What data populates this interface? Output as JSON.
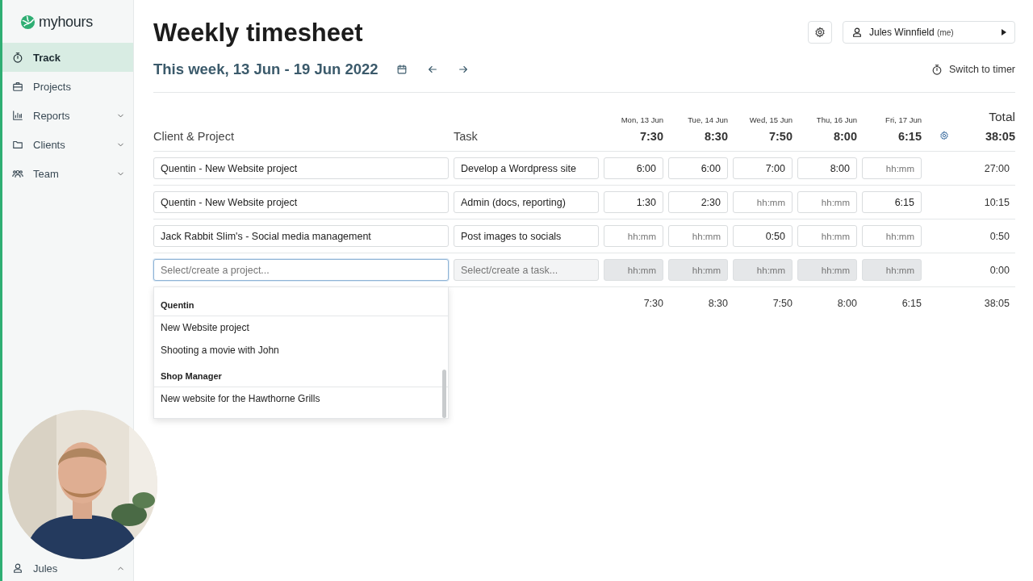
{
  "logo": {
    "text": "myhours"
  },
  "nav": [
    {
      "label": "Track",
      "selected": true,
      "kind": "link"
    },
    {
      "label": "Projects",
      "selected": false,
      "kind": "link"
    },
    {
      "label": "Reports",
      "selected": false,
      "kind": "group"
    },
    {
      "label": "Clients",
      "selected": false,
      "kind": "group"
    },
    {
      "label": "Team",
      "selected": false,
      "kind": "group"
    }
  ],
  "sidebar_user": {
    "label": "Jules"
  },
  "header": {
    "title": "Weekly timesheet",
    "week": "This week, 13 Jun - 19 Jun 2022",
    "user_name": "Jules Winnfield",
    "user_suffix": "(me)",
    "switch": "Switch to timer"
  },
  "columns": {
    "project": "Client & Project",
    "task": "Task",
    "total_label": "Total",
    "total": "38:05",
    "days": [
      {
        "date": "Mon, 13 Jun",
        "total": "7:30"
      },
      {
        "date": "Tue, 14 Jun",
        "total": "8:30"
      },
      {
        "date": "Wed, 15 Jun",
        "total": "7:50"
      },
      {
        "date": "Thu, 16 Jun",
        "total": "8:00"
      },
      {
        "date": "Fri, 17 Jun",
        "total": "6:15"
      }
    ]
  },
  "rows": [
    {
      "project": {
        "value": "Quentin - New Website project"
      },
      "task": {
        "value": "Develop a Wordpress site"
      },
      "disabled": false,
      "cells": [
        {
          "value": "6:00"
        },
        {
          "value": "6:00"
        },
        {
          "value": "7:00"
        },
        {
          "value": "8:00"
        },
        {
          "placeholder": "hh:mm"
        }
      ],
      "total": "27:00"
    },
    {
      "project": {
        "value": "Quentin - New Website project"
      },
      "task": {
        "value": "Admin (docs, reporting)"
      },
      "disabled": false,
      "cells": [
        {
          "value": "1:30"
        },
        {
          "value": "2:30"
        },
        {
          "placeholder": "hh:mm"
        },
        {
          "placeholder": "hh:mm"
        },
        {
          "value": "6:15"
        }
      ],
      "total": "10:15"
    },
    {
      "project": {
        "value": "Jack Rabbit Slim's - Social media management"
      },
      "task": {
        "value": "Post images to socials"
      },
      "disabled": false,
      "cells": [
        {
          "placeholder": "hh:mm"
        },
        {
          "placeholder": "hh:mm"
        },
        {
          "value": "0:50"
        },
        {
          "placeholder": "hh:mm"
        },
        {
          "placeholder": "hh:mm"
        }
      ],
      "total": "0:50"
    },
    {
      "project": {
        "placeholder": "Select/create a project...",
        "focused": true
      },
      "task": {
        "placeholder": "Select/create a task..."
      },
      "disabled": true,
      "cells": [
        {
          "placeholder": "hh:mm"
        },
        {
          "placeholder": "hh:mm"
        },
        {
          "placeholder": "hh:mm"
        },
        {
          "placeholder": "hh:mm"
        },
        {
          "placeholder": "hh:mm"
        }
      ],
      "total": "0:00"
    }
  ],
  "footer": {
    "days": [
      "7:30",
      "8:30",
      "7:50",
      "8:00",
      "6:15"
    ],
    "total": "38:05"
  },
  "dropdown": {
    "groups": [
      {
        "name": "Quentin",
        "items": [
          "New Website project",
          "Shooting a movie with John"
        ]
      },
      {
        "name": "Shop Manager",
        "items": [
          "New website for the Hawthorne Grills"
        ]
      }
    ]
  }
}
